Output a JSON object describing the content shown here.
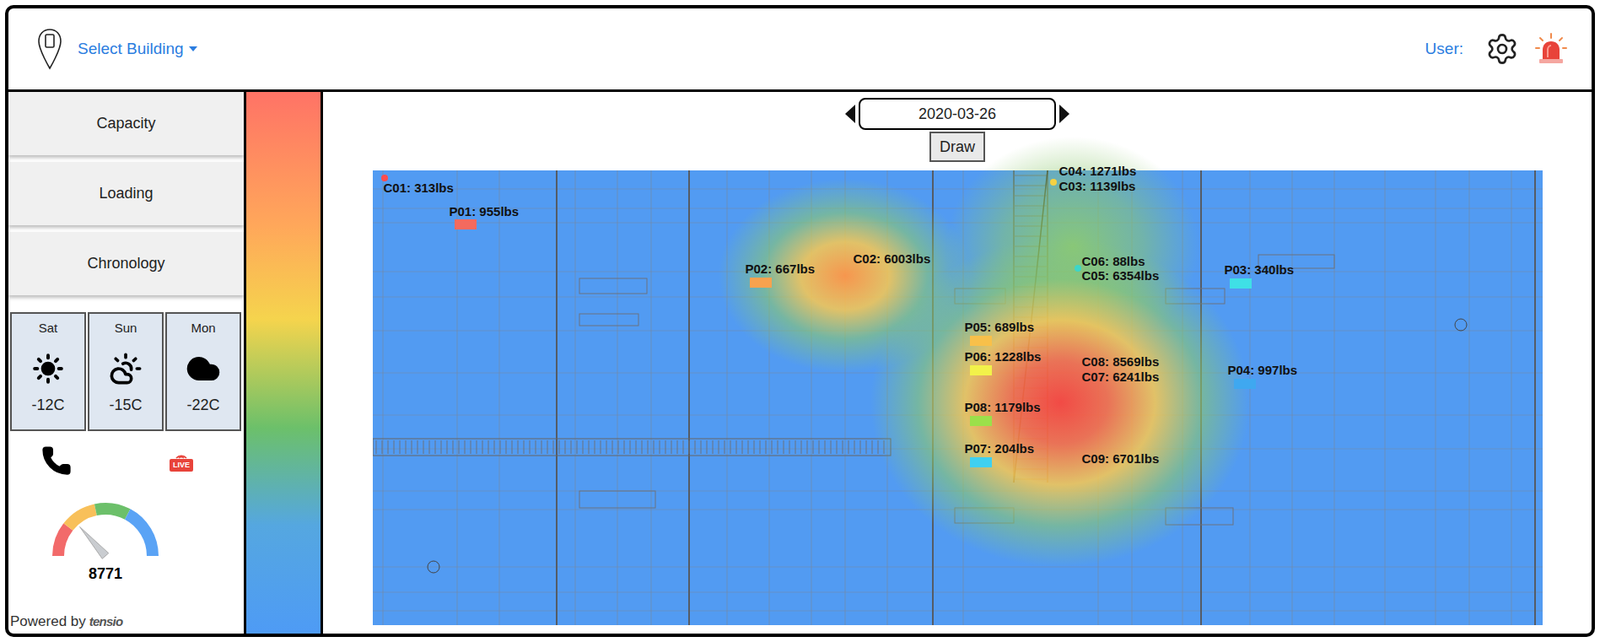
{
  "header": {
    "building_select": "Select Building",
    "user_label": "User:"
  },
  "nav": [
    {
      "label": "Capacity",
      "selected": false
    },
    {
      "label": "Loading",
      "selected": false
    },
    {
      "label": "Chronology",
      "selected": false
    }
  ],
  "forecast": [
    {
      "day": "Sat",
      "temp": "-12C",
      "kind": "sun"
    },
    {
      "day": "Sun",
      "temp": "-15C",
      "kind": "partly-cloudy"
    },
    {
      "day": "Mon",
      "temp": "-22C",
      "kind": "cloud"
    }
  ],
  "live_badge": "LIVE",
  "gauge": {
    "value": "8771",
    "level": 0.27
  },
  "footer": {
    "powered_by": "Powered by",
    "brand": "tensio"
  },
  "date": {
    "value": "2020-03-26"
  },
  "draw_button": "Draw",
  "sensors": [
    {
      "label": "C01: 313lbs",
      "kind": "column",
      "color": "#ff4d4d"
    },
    {
      "label": "P01: 955lbs",
      "kind": "point",
      "color": "#f46a5e"
    },
    {
      "label": "C04: 1271lbs",
      "kind": "column",
      "color": "#f5d142"
    },
    {
      "label": "C03: 1139lbs",
      "kind": "column"
    },
    {
      "label": "P02: 667lbs",
      "kind": "point",
      "color": "#f7a24e"
    },
    {
      "label": "C02: 6003lbs",
      "kind": "column"
    },
    {
      "label": "C06: 88lbs",
      "kind": "column",
      "color": "#3dd6c8"
    },
    {
      "label": "C05: 6354lbs",
      "kind": "column"
    },
    {
      "label": "P03: 340lbs",
      "kind": "point",
      "color": "#3fe0e6"
    },
    {
      "label": "P05: 689lbs",
      "kind": "point",
      "color": "#f8c04a"
    },
    {
      "label": "P06: 1228lbs",
      "kind": "point",
      "color": "#f2f24a"
    },
    {
      "label": "C08: 8569lbs",
      "kind": "column"
    },
    {
      "label": "C07: 6241lbs",
      "kind": "column"
    },
    {
      "label": "P04: 997lbs",
      "kind": "point",
      "color": "#3fa8f0"
    },
    {
      "label": "P08: 1179lbs",
      "kind": "point",
      "color": "#9be04a"
    },
    {
      "label": "P07: 204lbs",
      "kind": "point",
      "color": "#3fd0f0"
    },
    {
      "label": "C09: 6701lbs",
      "kind": "column"
    }
  ]
}
